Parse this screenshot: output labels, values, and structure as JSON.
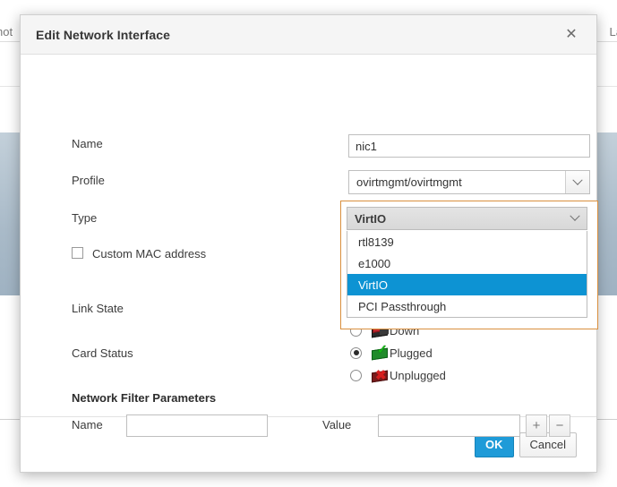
{
  "background": {
    "left_text": "hot",
    "right_text": "La"
  },
  "dialog": {
    "title": "Edit Network Interface",
    "close_icon": "close-icon",
    "fields": {
      "name": {
        "label": "Name",
        "value": "nic1",
        "placeholder": ""
      },
      "profile": {
        "label": "Profile",
        "value": "ovirtmgmt/ovirtmgmt",
        "arrow_icon": "chevron-down-icon"
      },
      "type": {
        "label": "Type",
        "value": "VirtIO",
        "arrow_icon": "chevron-down-icon",
        "expanded": true,
        "options": [
          {
            "label": "rtl8139",
            "selected": false
          },
          {
            "label": "e1000",
            "selected": false
          },
          {
            "label": "VirtIO",
            "selected": true
          },
          {
            "label": "PCI Passthrough",
            "selected": false
          }
        ]
      },
      "custom_mac": {
        "label": "Custom MAC address",
        "checked": false
      },
      "link_state": {
        "label": "Link State",
        "options": [
          {
            "label": "Down",
            "checked": false,
            "icon": "nic-down-icon"
          }
        ]
      },
      "card_status": {
        "label": "Card Status",
        "options": [
          {
            "label": "Plugged",
            "checked": true,
            "icon": "nic-plugged-icon"
          },
          {
            "label": "Unplugged",
            "checked": false,
            "icon": "nic-unplugged-icon"
          }
        ]
      }
    },
    "network_filter": {
      "section_title": "Network Filter Parameters",
      "name_label": "Name",
      "name_value": "",
      "value_label": "Value",
      "value_value": "",
      "add_label": "+",
      "remove_label": "−"
    },
    "footer": {
      "ok_label": "OK",
      "cancel_label": "Cancel"
    }
  },
  "colors": {
    "accent_blue": "#1f9bd8",
    "selected_option_blue": "#0d93d3",
    "focus_orange": "#d98f3e",
    "header_gray": "#f5f5f5"
  }
}
